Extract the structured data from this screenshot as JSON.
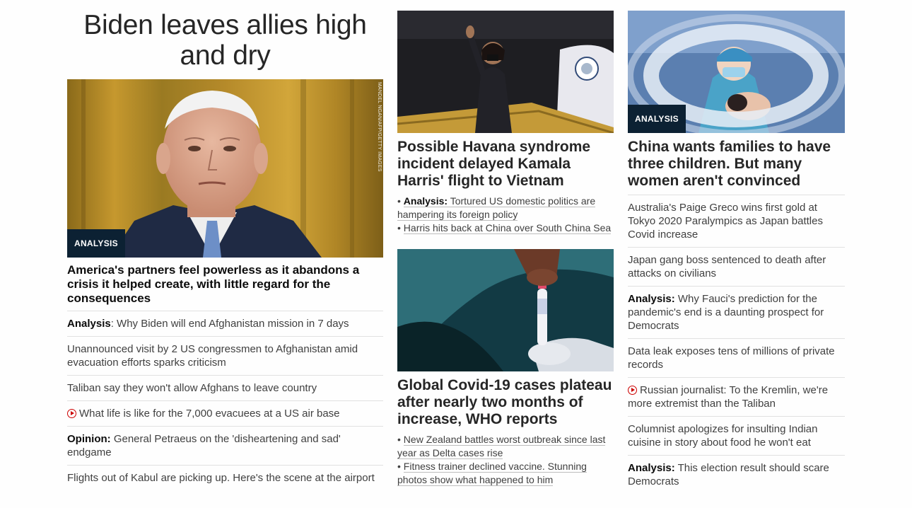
{
  "lead": {
    "title": "Biden leaves allies high and dry",
    "badge": "ANALYSIS",
    "photo_credit": "MANDEL NGAN/AFP/GETTY IMAGES",
    "headline": "America's partners feel powerless as it abandons a crisis it helped create, with little regard for the consequences",
    "items": [
      {
        "prefix": "Analysis",
        "text": ": Why Biden will end Afghanistan mission in 7 days"
      },
      {
        "prefix": "",
        "text": "Unannounced visit by 2 US congressmen to Afghanistan amid evacuation efforts sparks criticism"
      },
      {
        "prefix": "",
        "text": "Taliban say they won't allow Afghans to leave country"
      },
      {
        "prefix": "",
        "text": "What life is like for the 7,000 evacuees at a US air base"
      },
      {
        "prefix": "Opinion:",
        "text": " General Petraeus on the 'disheartening and sad' endgame"
      },
      {
        "prefix": "",
        "text": "Flights out of Kabul are picking up. Here's the scene at the airport"
      }
    ]
  },
  "middle": {
    "card1": {
      "headline": "Possible Havana syndrome incident delayed Kamala Harris' flight to Vietnam",
      "bullet1_prefix": "Analysis:",
      "bullet1_text": "Tortured US domestic politics are hampering its foreign policy",
      "bullet2_text": "Harris hits back at China over South China Sea"
    },
    "card2": {
      "headline": "Global Covid-19 cases plateau after nearly two months of increase, WHO reports",
      "bullet1_text": "New Zealand battles worst outbreak since last year as Delta cases rise",
      "bullet2_text": "Fitness trainer declined vaccine. Stunning photos show what happened to him"
    }
  },
  "right": {
    "badge": "ANALYSIS",
    "headline": "China wants families to have three children. But many women aren't convinced",
    "items": [
      {
        "prefix": "",
        "text": "Australia's Paige Greco wins first gold at Tokyo 2020 Paralympics as Japan battles Covid increase"
      },
      {
        "prefix": "",
        "text": "Japan gang boss sentenced to death after attacks on civilians"
      },
      {
        "prefix": "Analysis:",
        "text": " Why Fauci's prediction for the pandemic's end is a daunting prospect for Democrats"
      },
      {
        "prefix": "",
        "text": "Data leak exposes tens of millions of private records"
      },
      {
        "prefix": "",
        "text": "Russian journalist: To the Kremlin, we're more extremist than the Taliban"
      },
      {
        "prefix": "",
        "text": "Columnist apologizes for insulting Indian cuisine in story about food he won't eat"
      },
      {
        "prefix": "Analysis:",
        "text": " This election result should scare Democrats"
      }
    ]
  },
  "colors": {
    "badge_bg": "#0c2133",
    "video_red": "#cc0000",
    "divider": "#e1e1e1"
  },
  "icons": {
    "video": "play-circle-icon"
  }
}
